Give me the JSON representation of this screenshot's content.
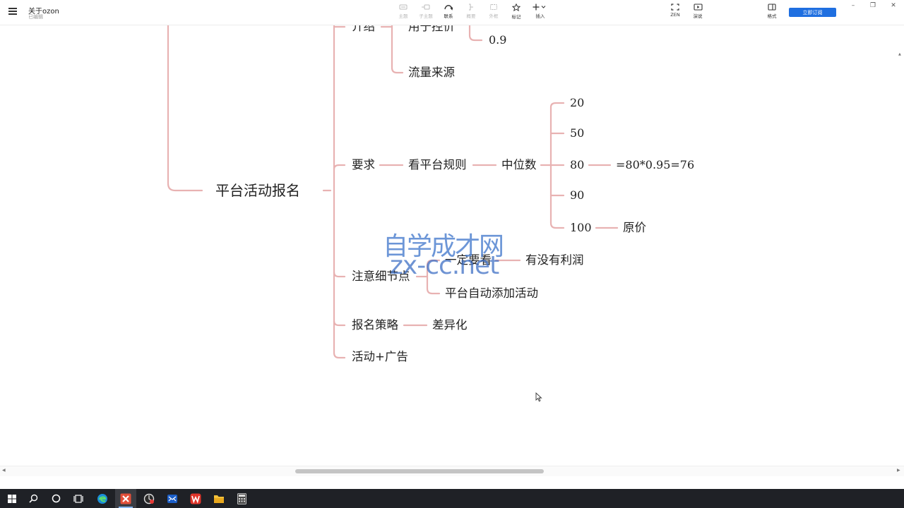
{
  "app": {
    "doc_title": "关于ozon",
    "doc_status": "已编辑",
    "toolbar": [
      {
        "id": "topic",
        "label": "主题",
        "icon": "topic-icon",
        "enabled": false
      },
      {
        "id": "subtopic",
        "label": "子主题",
        "icon": "subtopic-icon",
        "enabled": false
      },
      {
        "id": "relation",
        "label": "联系",
        "icon": "relation-icon",
        "enabled": true
      },
      {
        "id": "summary",
        "label": "概要",
        "icon": "summary-icon",
        "enabled": false
      },
      {
        "id": "boundary",
        "label": "外框",
        "icon": "boundary-icon",
        "enabled": false
      },
      {
        "id": "marker",
        "label": "标记",
        "icon": "star-icon",
        "enabled": true
      },
      {
        "id": "insert",
        "label": "插入",
        "icon": "plus-icon",
        "enabled": true
      },
      {
        "id": "zen",
        "label": "ZEN",
        "icon": "fullscreen-icon",
        "enabled": true
      },
      {
        "id": "present",
        "label": "演说",
        "icon": "presentation-icon",
        "enabled": true
      },
      {
        "id": "format",
        "label": "格式",
        "icon": "panel-icon",
        "enabled": true
      }
    ],
    "subscribe_label": "立即订阅",
    "window_controls": {
      "minimize": "–",
      "restore": "❐",
      "close": "✕"
    }
  },
  "mindmap": {
    "root": "平台活动报名",
    "branches": {
      "intro": "介绍",
      "requirements": "要求",
      "details": "注意细节点",
      "strategy": "报名策略",
      "activity_ads": "活动+广告"
    },
    "intro_children": {
      "pricing": "用于控价",
      "pricing_value": "0.9",
      "traffic": "流量来源"
    },
    "requirements_children": {
      "rules": "看平台规则",
      "median": "中位数",
      "values": [
        "20",
        "50",
        "80",
        "90",
        "100"
      ],
      "calc": "=80*0.95=76",
      "original": "原价"
    },
    "details_children": {
      "must_check": "一定要看",
      "profit": "有没有利润",
      "auto_add": "平台自动添加活动"
    },
    "strategy_children": {
      "diff": "差异化"
    },
    "line_color": "#e8b2b2"
  },
  "watermark": {
    "cn": "自学成才网",
    "en": "zx-cc.net",
    "color": "#4d7fcf"
  },
  "taskbar": {
    "items": [
      "windows-start-icon",
      "search-icon",
      "cortana-icon",
      "task-view-icon",
      "edge-icon",
      "xmind-icon",
      "recorder-icon",
      "mail-icon",
      "wps-icon",
      "file-explorer-icon",
      "calculator-icon"
    ],
    "active": "xmind-icon"
  }
}
